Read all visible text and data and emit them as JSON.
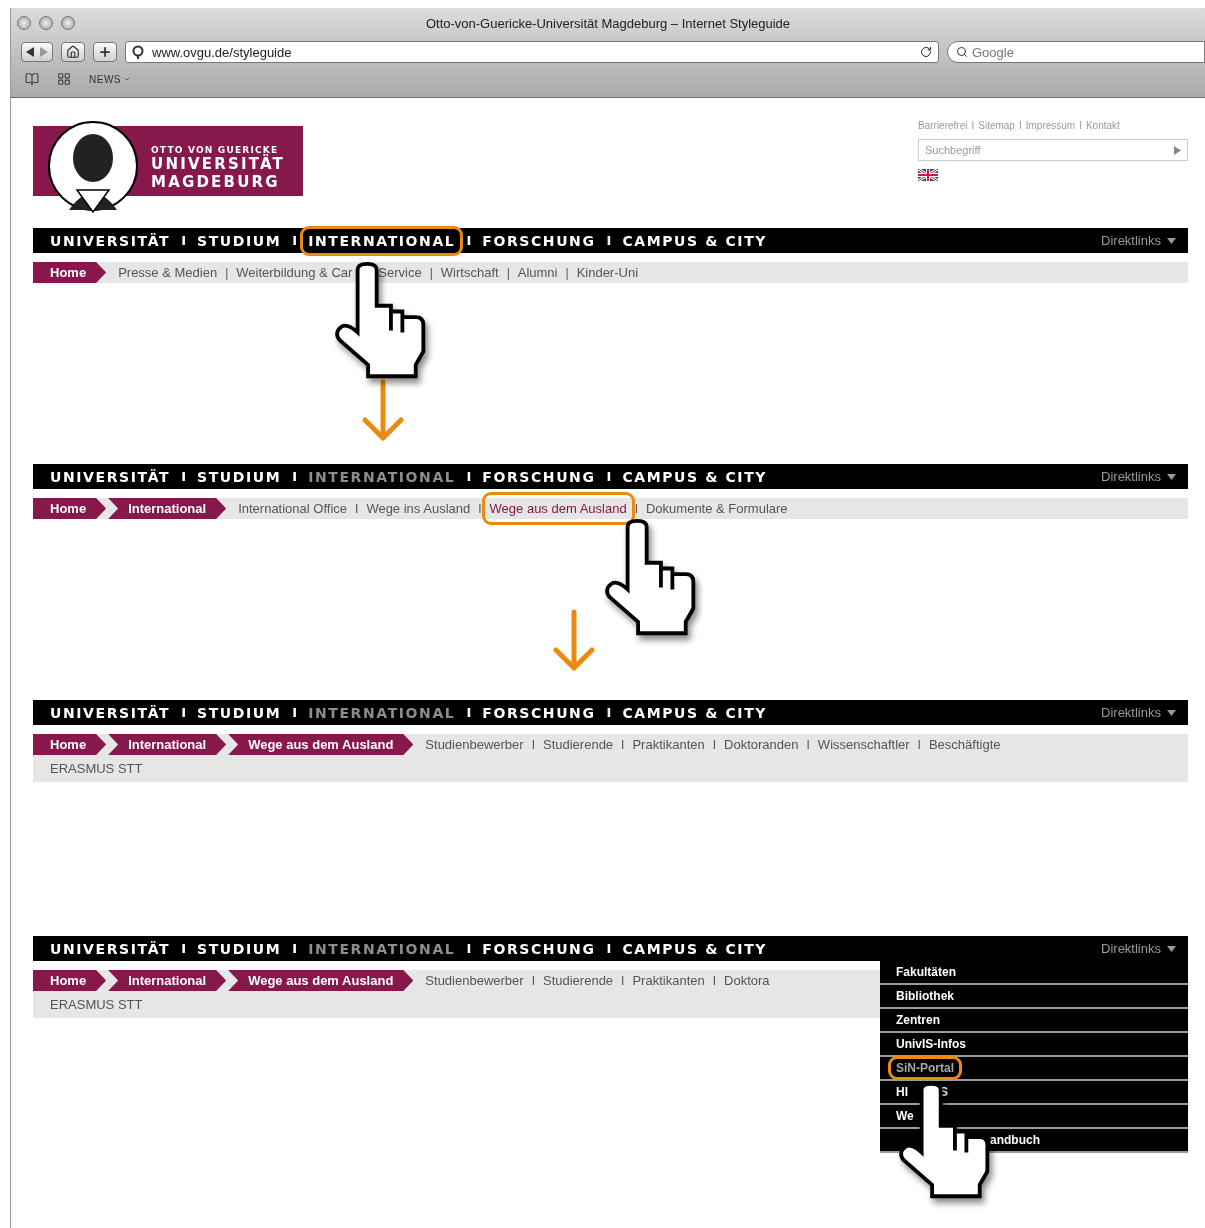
{
  "browser": {
    "title": "Otto-von-Guericke-Universität Magdeburg – Internet Styleguide",
    "url": "www.ovgu.de/styleguide",
    "search_placeholder": "Google",
    "bookmarks": [
      {
        "label": "NEWS"
      }
    ]
  },
  "header": {
    "logo": {
      "small": "OTTO VON GUERICKE",
      "line1": "UNIVERSITÄT",
      "line2": "MAGDEBURG"
    },
    "service_links": [
      {
        "label": "Barrierefrei"
      },
      {
        "sep": "I",
        "label": "Sitemap"
      },
      {
        "sep": "I",
        "label": "Impressum"
      },
      {
        "sep": "I",
        "label": "Kontakt"
      }
    ],
    "search": {
      "placeholder": "Suchbegriff"
    }
  },
  "steps": [
    {
      "main_nav": {
        "direktlinks": "Direktlinks",
        "items": [
          {
            "label": "UNIVERSITÄT",
            "selected": false,
            "highlighted": false
          },
          {
            "sep": "I",
            "label": "STUDIUM",
            "selected": false,
            "highlighted": false
          },
          {
            "sep": "I",
            "label": "INTERNATIONAL",
            "selected": false,
            "highlighted": true
          },
          {
            "sep": "I",
            "label": "FORSCHUNG",
            "selected": false,
            "highlighted": false
          },
          {
            "sep": "I",
            "label": "CAMPUS & CITY",
            "selected": false,
            "highlighted": false
          }
        ]
      },
      "breadcrumbs": [
        "Home"
      ],
      "subnav": {
        "rows": [
          [
            {
              "label": "Presse & Medien",
              "highlighted": false
            },
            {
              "sep": "|",
              "label": "Weiterbildung & Car",
              "after_cursor": "Service",
              "highlighted": false
            },
            {
              "sep": "|",
              "label": "Wirtschaft",
              "highlighted": false
            },
            {
              "sep": "|",
              "label": "Alumni",
              "highlighted": false
            },
            {
              "sep": "|",
              "label": "Kinder-Uni",
              "highlighted": false
            }
          ]
        ]
      }
    },
    {
      "main_nav": {
        "direktlinks": "Direktlinks",
        "items": [
          {
            "label": "UNIVERSITÄT",
            "selected": false,
            "highlighted": false
          },
          {
            "sep": "I",
            "label": "STUDIUM",
            "selected": false,
            "highlighted": false
          },
          {
            "sep": "I",
            "label": "INTERNATIONAL",
            "selected": true,
            "highlighted": false
          },
          {
            "sep": "I",
            "label": "FORSCHUNG",
            "selected": false,
            "highlighted": false
          },
          {
            "sep": "I",
            "label": "CAMPUS & CITY",
            "selected": false,
            "highlighted": false
          }
        ]
      },
      "breadcrumbs": [
        "Home",
        "International"
      ],
      "subnav": {
        "rows": [
          [
            {
              "label": "International Office",
              "highlighted": false
            },
            {
              "sep": "I",
              "label": "Wege ins Ausland",
              "highlighted": false
            },
            {
              "sep": "I",
              "label": "Wege aus dem Ausland",
              "highlighted": true
            },
            {
              "sep": "I",
              "label": "Dokumente & Formulare",
              "highlighted": false
            }
          ]
        ]
      }
    },
    {
      "main_nav": {
        "direktlinks": "Direktlinks",
        "items": [
          {
            "label": "UNIVERSITÄT",
            "selected": false,
            "highlighted": false
          },
          {
            "sep": "I",
            "label": "STUDIUM",
            "selected": false,
            "highlighted": false
          },
          {
            "sep": "I",
            "label": "INTERNATIONAL",
            "selected": true,
            "highlighted": false
          },
          {
            "sep": "I",
            "label": "FORSCHUNG",
            "selected": false,
            "highlighted": false
          },
          {
            "sep": "I",
            "label": "CAMPUS & CITY",
            "selected": false,
            "highlighted": false
          }
        ]
      },
      "breadcrumbs": [
        "Home",
        "International",
        "Wege aus dem Ausland"
      ],
      "subnav": {
        "rows": [
          [
            {
              "label": "Studienbewerber",
              "highlighted": false
            },
            {
              "sep": "I",
              "label": "Studierende",
              "highlighted": false
            },
            {
              "sep": "I",
              "label": "Praktikanten",
              "highlighted": false
            },
            {
              "sep": "I",
              "label": "Doktoranden",
              "highlighted": false
            },
            {
              "sep": "I",
              "label": "Wissenschaftler",
              "highlighted": false
            },
            {
              "sep": "I",
              "label": "Beschäftigte",
              "highlighted": false
            }
          ],
          [
            {
              "label": "ERASMUS STT",
              "highlighted": false
            }
          ]
        ]
      }
    },
    {
      "main_nav": {
        "direktlinks": "Direktlinks",
        "items": [
          {
            "label": "UNIVERSITÄT",
            "selected": false,
            "highlighted": false
          },
          {
            "sep": "I",
            "label": "STUDIUM",
            "selected": false,
            "highlighted": false
          },
          {
            "sep": "I",
            "label": "INTERNATIONAL",
            "selected": true,
            "highlighted": false
          },
          {
            "sep": "I",
            "label": "FORSCHUNG",
            "selected": false,
            "highlighted": false
          },
          {
            "sep": "I",
            "label": "CAMPUS & CITY",
            "selected": false,
            "highlighted": false
          }
        ]
      },
      "breadcrumbs": [
        "Home",
        "International",
        "Wege aus dem Ausland"
      ],
      "subnav": {
        "rows": [
          [
            {
              "label": "Studienbewerber",
              "highlighted": false
            },
            {
              "sep": "I",
              "label": "Studierende",
              "highlighted": false
            },
            {
              "sep": "I",
              "label": "Praktikanten",
              "highlighted": false
            },
            {
              "sep": "I",
              "label": "Doktora",
              "highlighted": false
            }
          ],
          [
            {
              "label": "ERASMUS STT",
              "highlighted": false
            }
          ]
        ]
      },
      "dropdown": {
        "items": [
          {
            "label": "Fakultäten",
            "highlighted": false
          },
          {
            "label": "Bibliothek",
            "highlighted": false
          },
          {
            "label": "Zentren",
            "highlighted": false
          },
          {
            "label": "UnivIS-Infos",
            "highlighted": false
          },
          {
            "label": "SiN-Portal",
            "highlighted": true
          },
          {
            "label": "HI",
            "after_cursor": "S",
            "highlighted": false
          },
          {
            "label": "We",
            "highlighted": false
          },
          {
            "after_cursor": "andbuch",
            "highlighted": false
          }
        ]
      }
    }
  ]
}
